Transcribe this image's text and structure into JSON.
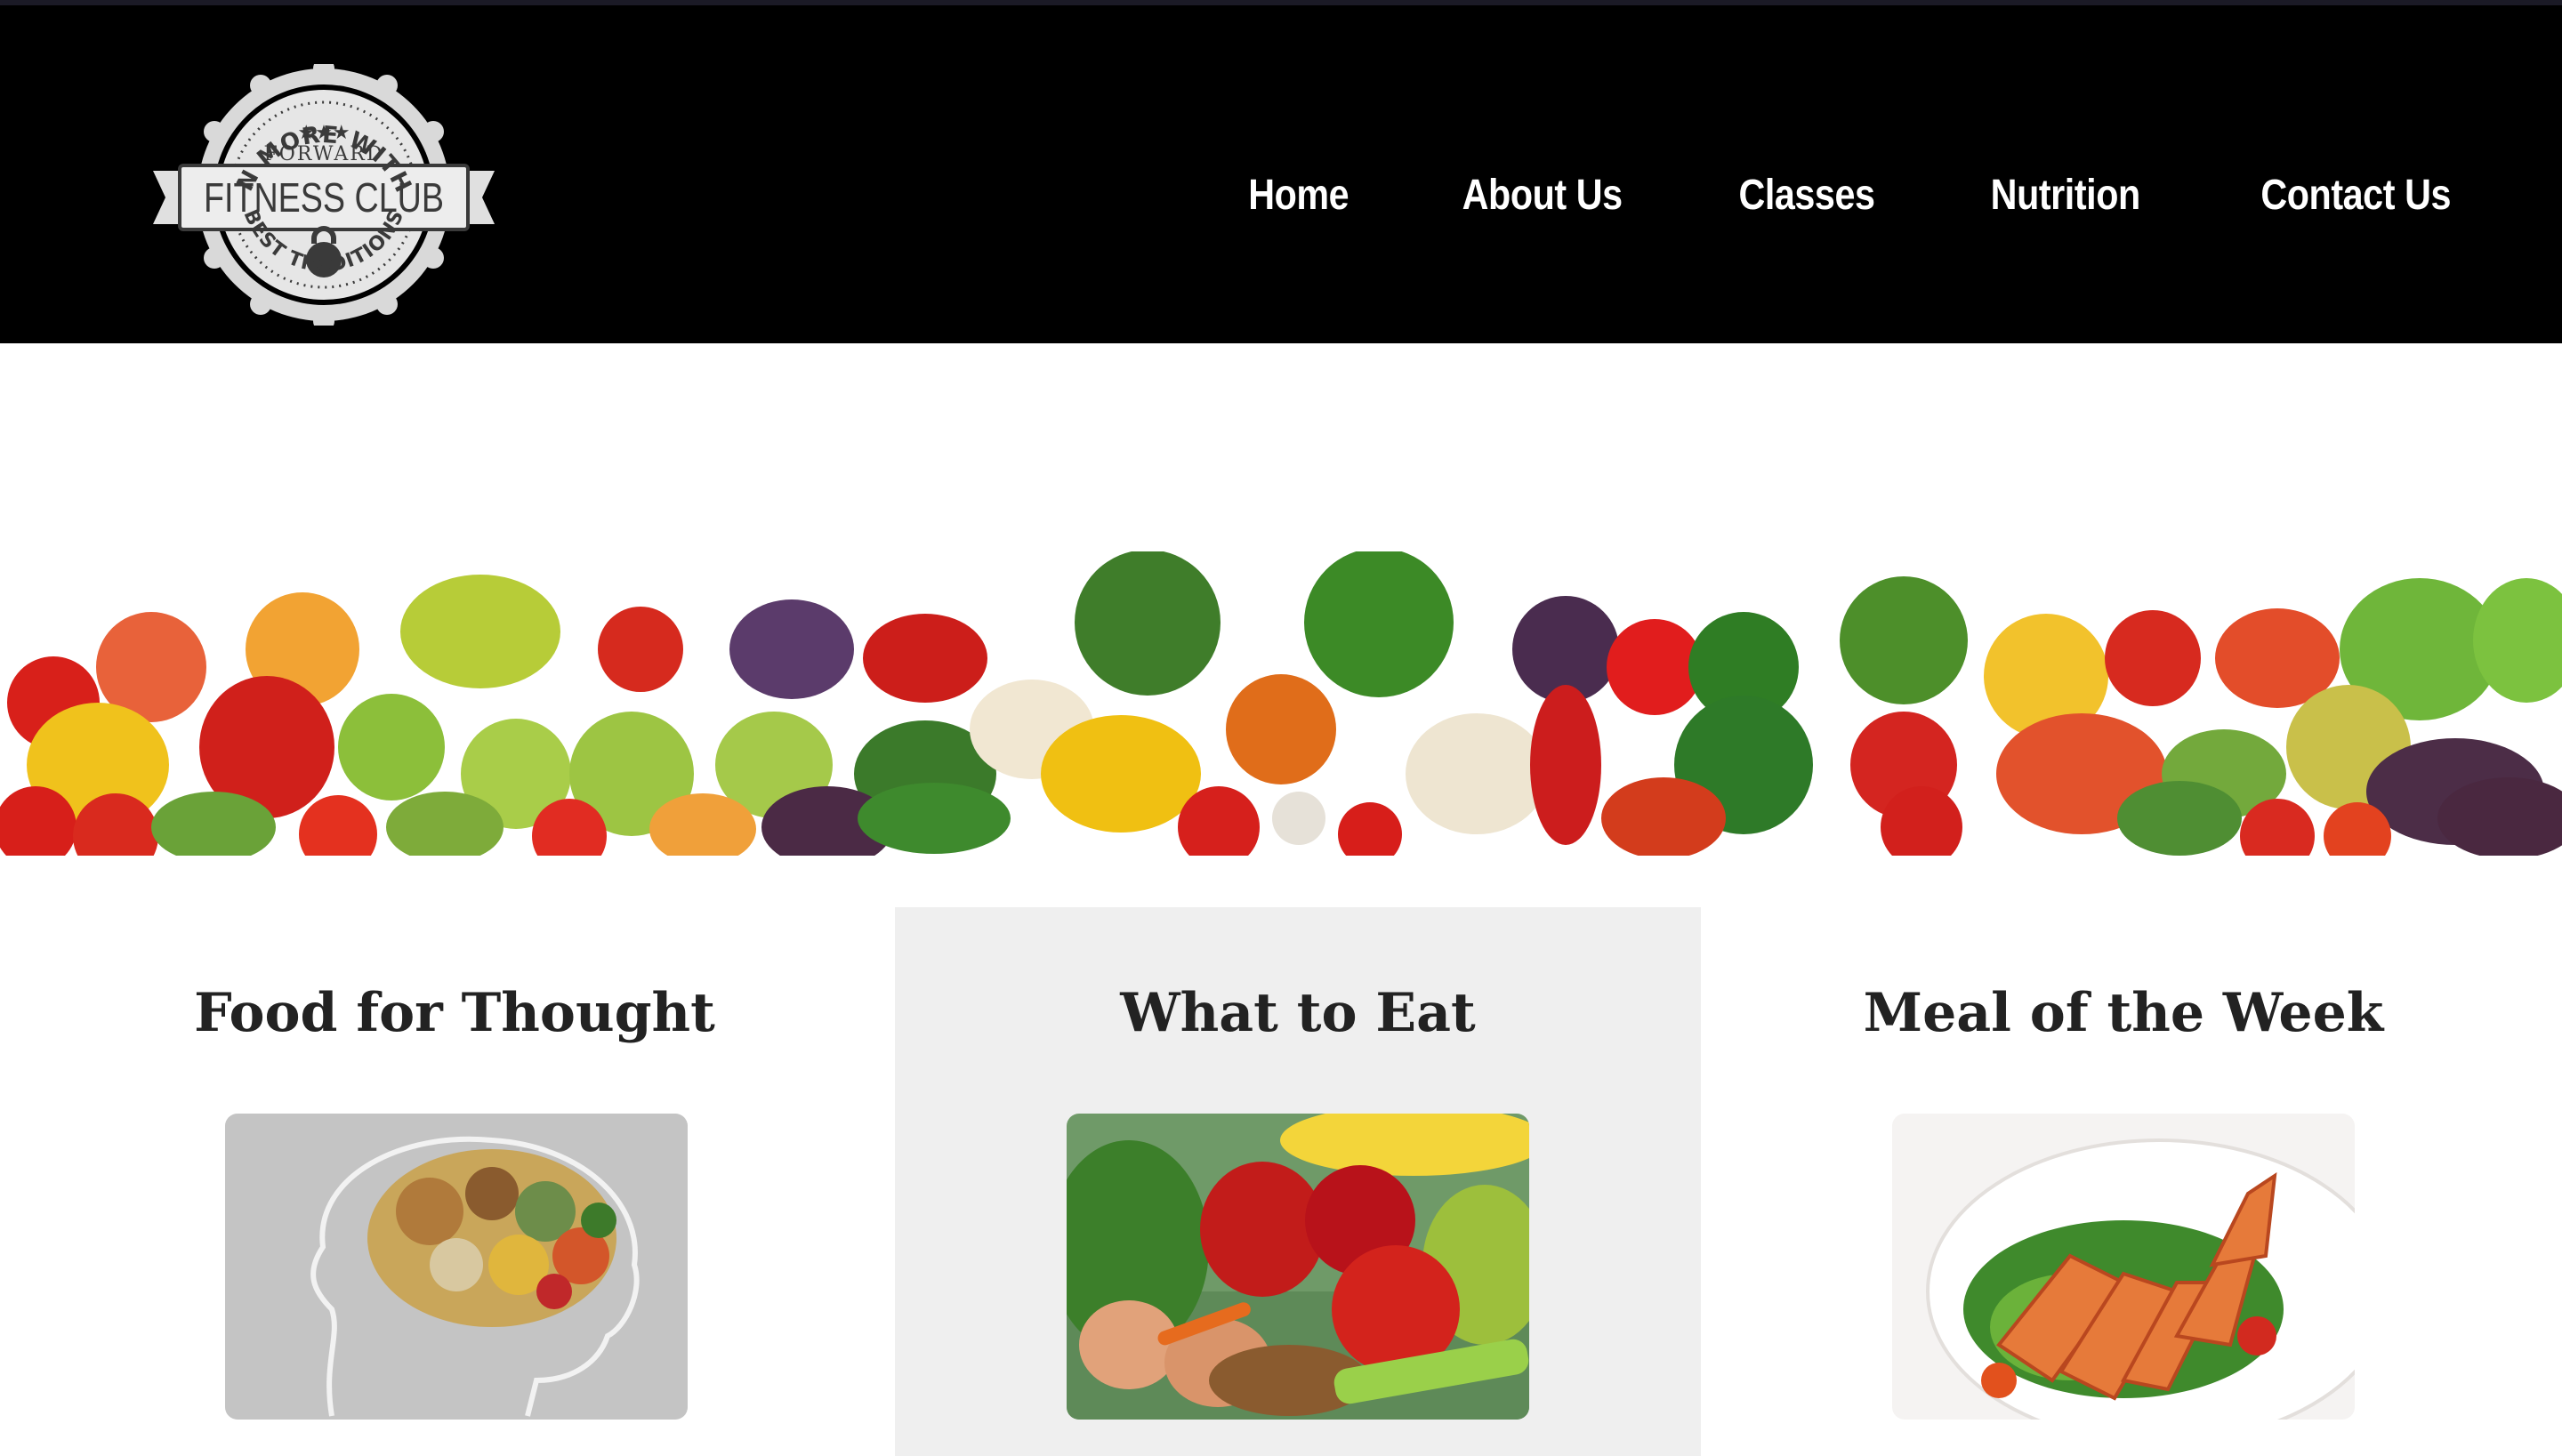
{
  "window": {
    "background": "#ffffff"
  },
  "header": {
    "background": "#000000",
    "logo": {
      "top_arc": "GAIN MORE WITH US",
      "stars": "★★★",
      "subtitle": "FORWARD",
      "title": "FITNESS CLUB",
      "bottom_arc": "BEST TRADITIONS"
    },
    "nav": [
      {
        "label": "Home"
      },
      {
        "label": "About Us"
      },
      {
        "label": "Classes"
      },
      {
        "label": "Nutrition"
      },
      {
        "label": "Contact Us"
      }
    ]
  },
  "banner": {
    "image": "vegetables-and-fruits-row"
  },
  "cards": [
    {
      "title": "Food for Thought",
      "image": "brain-made-of-food"
    },
    {
      "title": "What to Eat",
      "image": "vegetables-fruits-eggs-nuts",
      "background": "#efefef"
    },
    {
      "title": "Meal of the Week",
      "image": "grilled-chicken-salad"
    }
  ]
}
